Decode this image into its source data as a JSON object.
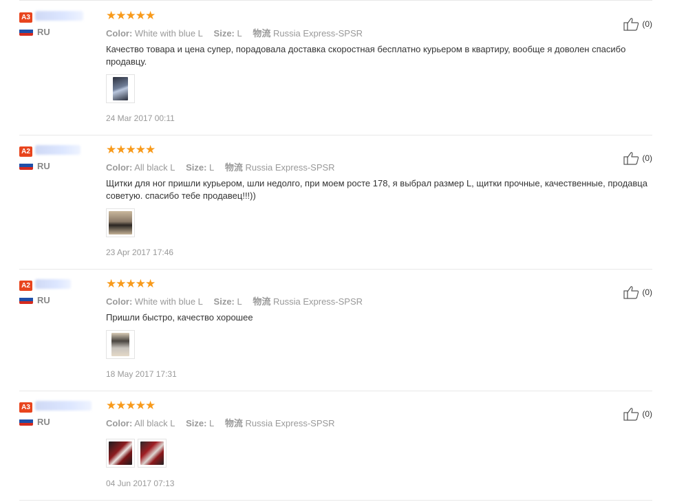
{
  "reviews": [
    {
      "level": "A3",
      "country": "RU",
      "stars": "★★★★★",
      "color_label": "Color:",
      "color_value": "White with blue L",
      "size_label": "Size:",
      "size_value": "L",
      "shipping_label": "物流",
      "shipping_value": "Russia Express-SPSR",
      "text": "Качество товара и цена супер, порадовала доставка скоростная бесплатно курьером в квартиру, вообще я доволен спасибо продавцу.",
      "date": "24 Mar 2017 00:11",
      "likes": "(0)"
    },
    {
      "level": "A2",
      "country": "RU",
      "stars": "★★★★★",
      "color_label": "Color:",
      "color_value": "All black L",
      "size_label": "Size:",
      "size_value": "L",
      "shipping_label": "物流",
      "shipping_value": "Russia Express-SPSR",
      "text": "Щитки для ног пришли курьером, шли недолго, при моем росте 178, я выбрал размер L, щитки прочные, качественные, продавца советую. спасибо тебе продавец!!!))",
      "date": "23 Apr 2017 17:46",
      "likes": "(0)"
    },
    {
      "level": "A2",
      "country": "RU",
      "stars": "★★★★★",
      "color_label": "Color:",
      "color_value": "White with blue L",
      "size_label": "Size:",
      "size_value": "L",
      "shipping_label": "物流",
      "shipping_value": "Russia Express-SPSR",
      "text": "Пришли быстро, качество хорошее",
      "date": "18 May 2017 17:31",
      "likes": "(0)"
    },
    {
      "level": "A3",
      "country": "RU",
      "stars": "★★★★★",
      "color_label": "Color:",
      "color_value": "All black L",
      "size_label": "Size:",
      "size_value": "L",
      "shipping_label": "物流",
      "shipping_value": "Russia Express-SPSR",
      "text": "",
      "date": "04 Jun 2017 07:13",
      "likes": "(0)"
    }
  ],
  "colors": {
    "star": "#f89a1b",
    "level_badge": "#e8451e",
    "flag_white": "#ffffff",
    "flag_blue": "#1f4fa8",
    "flag_red": "#d52b1e"
  },
  "icons": {
    "like": "thumbs-up-icon",
    "flag": "russia-flag-icon"
  }
}
